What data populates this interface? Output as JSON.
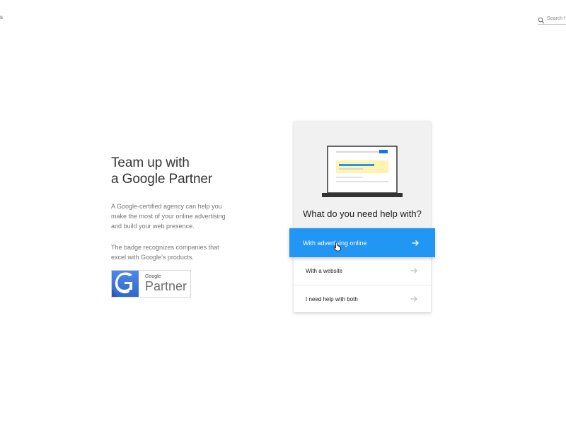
{
  "page": {
    "left_edge_fragment": "s"
  },
  "search": {
    "placeholder": "Search f",
    "icon": "search-icon"
  },
  "intro": {
    "headline_line1": "Team up with",
    "headline_line2": "a Google Partner",
    "paragraph1_line1": "A Google-certified agency can help you",
    "paragraph1_line2": "make the most of your online advertising",
    "paragraph1_line3": "and build your web presence.",
    "paragraph2_line1": "The badge recognizes companies that",
    "paragraph2_line2": "excel with Google’s products."
  },
  "badge": {
    "small_text": "Google",
    "large_text": "Partner",
    "icon": "google-g-icon"
  },
  "help_card": {
    "question": "What do you need help with?",
    "illustration": "laptop-ad-illustration-icon",
    "options": [
      {
        "label": "With advertising online",
        "selected": true,
        "icon": "arrow-right-icon"
      },
      {
        "label": "With a website",
        "selected": false,
        "icon": "arrow-right-icon"
      },
      {
        "label": "I need help with both",
        "selected": false,
        "icon": "arrow-right-icon"
      }
    ]
  },
  "colors": {
    "accent": "#2196f3",
    "card_gray": "#f1f1f1",
    "text_dark": "#202124",
    "text_muted": "#757575",
    "highlight_blue": "#1a73e8",
    "highlight_yellow": "#fff3b0"
  }
}
